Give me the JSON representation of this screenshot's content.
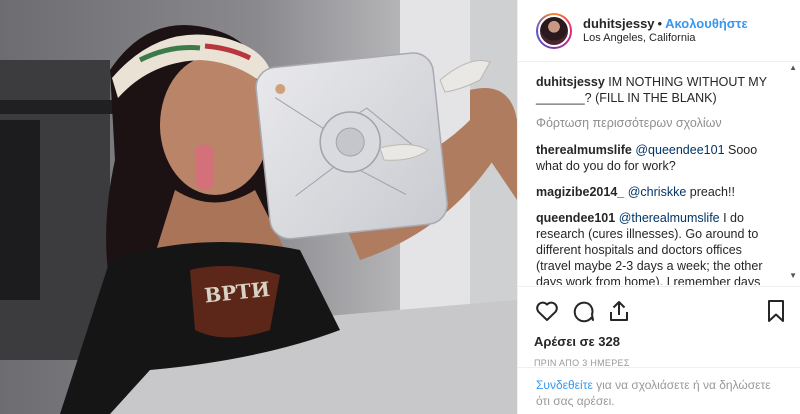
{
  "post": {
    "image_alt": "photo",
    "header": {
      "username": "duhitsjessy",
      "dot": "•",
      "follow_label": "Ακολουθήστε",
      "location": "Los Angeles, California"
    },
    "caption": {
      "username": "duhitsjessy",
      "text": "IM NOTHING WITHOUT MY _______? (FILL IN THE BLANK)"
    },
    "load_more_label": "Φόρτωση περισσότερων σχολίων",
    "comments": [
      {
        "username": "therealmumslife",
        "mention": "@queendee101",
        "text": " Sooo what do you do for work?"
      },
      {
        "username": "magizibe2014_",
        "mention": "@chriskke",
        "text": " preach!!"
      },
      {
        "username": "queendee101",
        "mention": "@therealmumslife",
        "text": " I do research (cures illnesses). Go around to different hospitals and doctors offices (travel maybe 2-3 days a week; the other days work from home). I remember days having to put in request to be off of work,"
      }
    ],
    "actions": {
      "icons": [
        "heart-icon",
        "comment-icon",
        "share-icon",
        "bookmark-icon"
      ]
    },
    "likes_label": "Αρέσει σε 328",
    "time_label": "ΠΡΙΝ ΑΠΟ 3 ΗΜΕΡΕΣ",
    "login_prompt": {
      "link_text": "Συνδεθείτε",
      "rest_text": " για να σχολιάσετε ή να δηλώσετε ότι σας αρέσει."
    }
  },
  "colors": {
    "accent_blue": "#3897f0",
    "mention_blue": "#003569",
    "muted_gray": "#8e8e8e",
    "border": "#efefef"
  }
}
